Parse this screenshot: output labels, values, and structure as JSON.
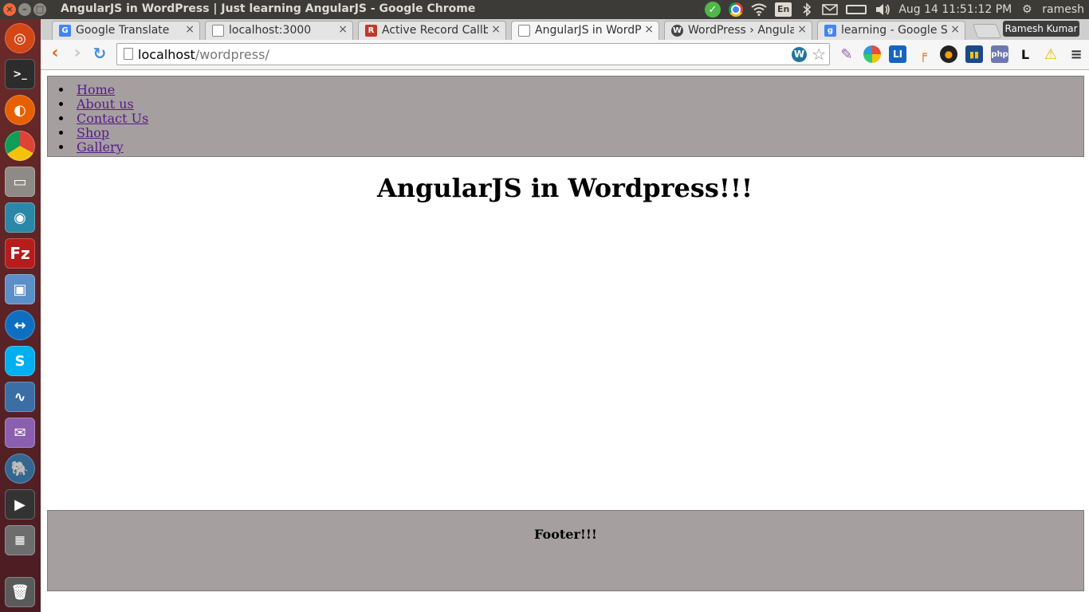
{
  "top_panel": {
    "window_title": "AngularJS in WordPress | Just learning AngularJS - Google Chrome",
    "input_method": "En",
    "clock": "Aug 14 11:51:12 PM",
    "user": "ramesh"
  },
  "launcher": {
    "apps": [
      "ubuntu-dash",
      "terminal",
      "firefox",
      "chrome",
      "files",
      "web-browser",
      "filezilla",
      "virtualbox",
      "teamviewer",
      "skype",
      "system-monitor",
      "pidgin",
      "pgadmin",
      "video-editor",
      "calculator",
      "trash"
    ]
  },
  "browser": {
    "tabs": [
      {
        "title": "Google Translate",
        "favicon": "translate-icon",
        "favicon_color": "#4285f4",
        "active": false
      },
      {
        "title": "localhost:3000",
        "favicon": "page-icon",
        "favicon_color": "#ffffff",
        "active": false
      },
      {
        "title": "Active Record Callba",
        "favicon": "rails-icon",
        "favicon_color": "#c0392b",
        "active": false
      },
      {
        "title": "AngularJS in WordP",
        "favicon": "page-icon",
        "favicon_color": "#ffffff",
        "active": true
      },
      {
        "title": "WordPress › Angular",
        "favicon": "wordpress-icon",
        "favicon_color": "#464646",
        "active": false
      },
      {
        "title": "learning - Google Se",
        "favicon": "google-icon",
        "favicon_color": "#4285f4",
        "active": false
      }
    ],
    "profile_name": "Ramesh Kumar",
    "url_host": "localhost",
    "url_path": "/wordpress/"
  },
  "page": {
    "nav_items": [
      "Home",
      "About us",
      "Contact Us",
      "Shop",
      "Gallery"
    ],
    "heading": "AngularJS in Wordpress!!!",
    "footer": "Footer!!!",
    "nav_bg_color": "#a5a09f",
    "link_color": "#551a8b"
  }
}
